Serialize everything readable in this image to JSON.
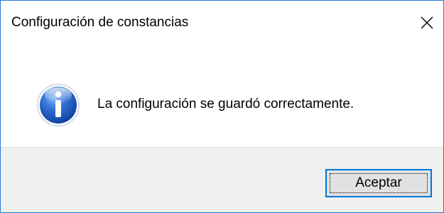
{
  "window": {
    "title": "Configuración de constancias",
    "close_icon": "close-icon",
    "border_color": "#2b79d7"
  },
  "message": {
    "icon": "info-icon",
    "text": "La configuración se guardó correctamente."
  },
  "buttons": {
    "ok_label": "Aceptar",
    "ok_focused": true,
    "ok_border_color": "#0078d7"
  }
}
